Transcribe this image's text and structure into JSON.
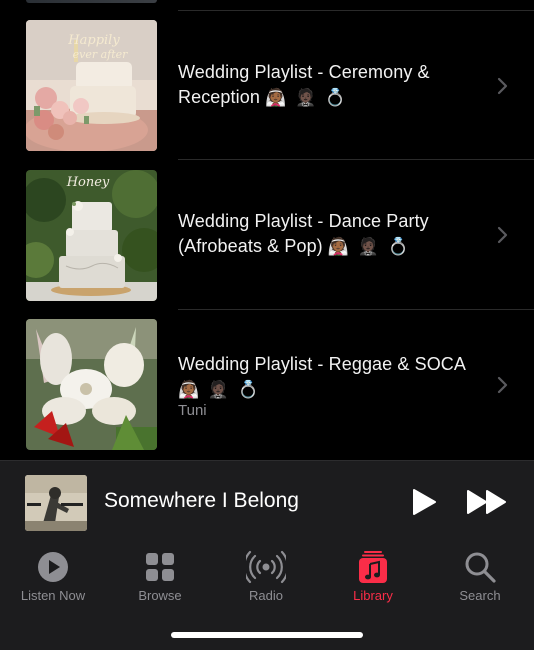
{
  "playlists": [
    {
      "title": "Wedding Playlist - Ceremony & Reception",
      "emojis": "👰🏾 🤵🏿 💍",
      "subtitle": "",
      "art": "wedding-cake-pink-flowers"
    },
    {
      "title": "Wedding Playlist - Dance Party (Afrobeats & Pop)",
      "emojis": "👰🏾 🤵🏿 💍",
      "subtitle": "",
      "art": "three-tier-wedding-cake"
    },
    {
      "title": "Wedding Playlist - Reggae & SOCA",
      "emojis": "👰🏾 🤵🏿 💍",
      "subtitle": "Tuni",
      "art": "tropical-flower-bouquet"
    }
  ],
  "now_playing": {
    "title": "Somewhere I Belong",
    "controls": [
      "play-icon",
      "fast-forward-icon"
    ]
  },
  "tabs": [
    {
      "label": "Listen Now",
      "icon": "play-circle-icon",
      "active": false
    },
    {
      "label": "Browse",
      "icon": "grid-icon",
      "active": false
    },
    {
      "label": "Radio",
      "icon": "radio-waves-icon",
      "active": false
    },
    {
      "label": "Library",
      "icon": "music-library-icon",
      "active": true
    },
    {
      "label": "Search",
      "icon": "magnifier-icon",
      "active": false
    }
  ],
  "colors": {
    "accent": "#fa2d48",
    "background": "#000000",
    "bar": "#1c1c1e",
    "secondary_text": "#8e8e93"
  }
}
